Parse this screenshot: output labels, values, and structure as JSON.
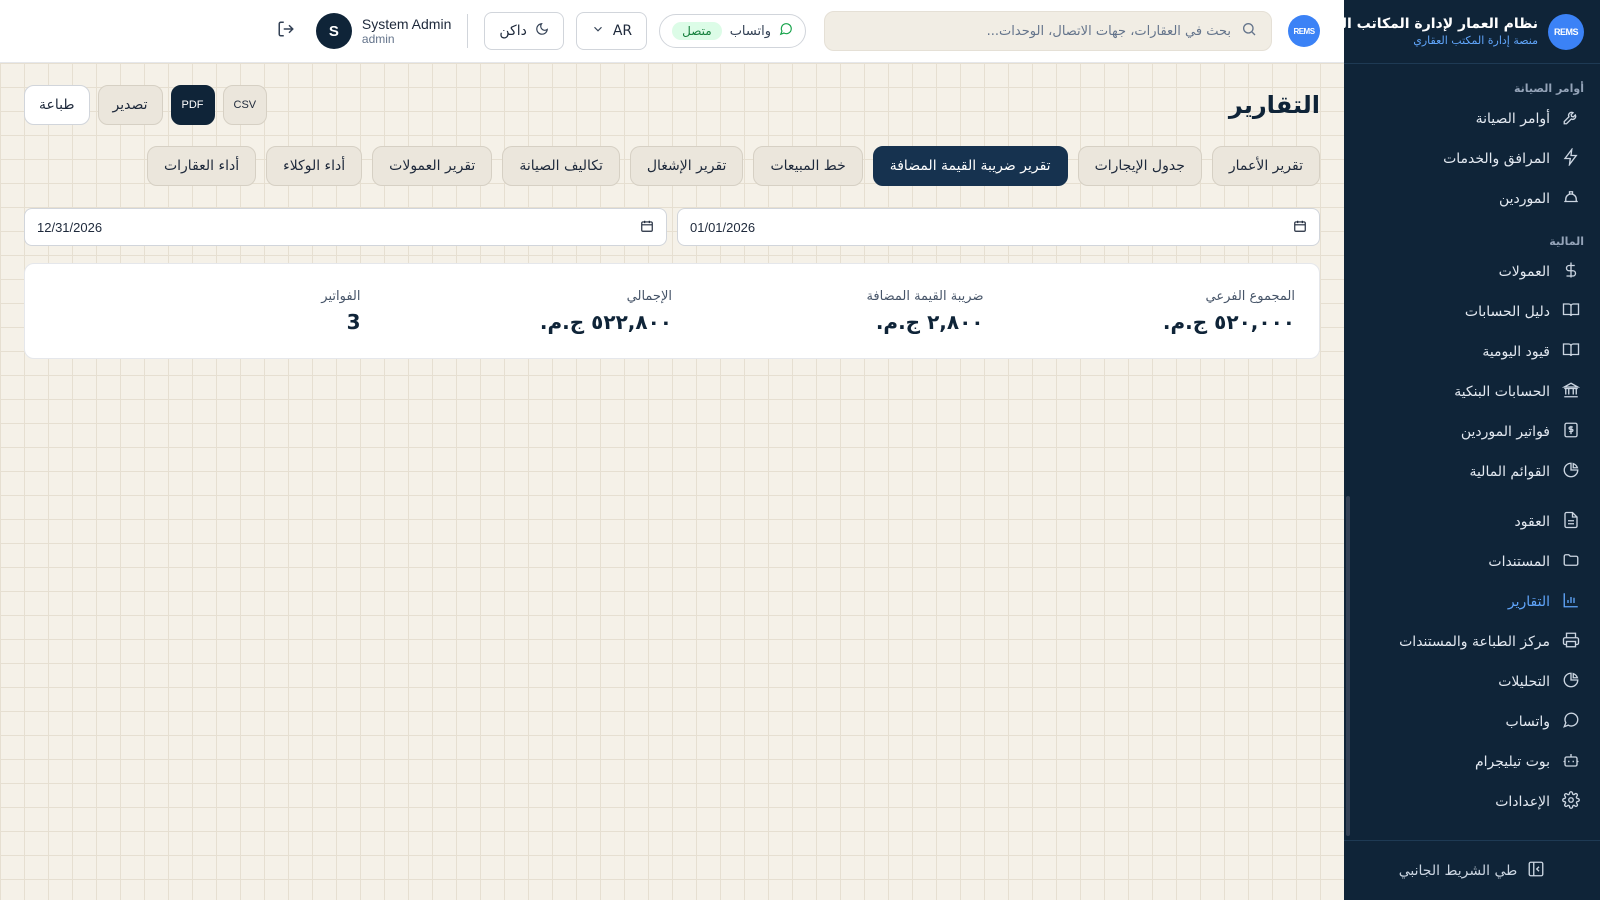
{
  "brand": {
    "logo_text": "REMS",
    "title": "نظام العمار لإدارة المكاتب العقارية",
    "subtitle": "منصة إدارة المكتب العقاري"
  },
  "sidebar": {
    "sections": [
      {
        "label": "أوامر الصيانة",
        "items": [
          {
            "label": "أوامر الصيانة",
            "icon": "wrench-icon"
          },
          {
            "label": "المرافق والخدمات",
            "icon": "bolt-icon"
          },
          {
            "label": "الموردين",
            "icon": "hard-hat-icon"
          }
        ]
      },
      {
        "label": "المالية",
        "items": [
          {
            "label": "العمولات",
            "icon": "dollar-icon"
          },
          {
            "label": "دليل الحسابات",
            "icon": "book-icon"
          },
          {
            "label": "قيود اليومية",
            "icon": "book-open-icon"
          },
          {
            "label": "الحسابات البنكية",
            "icon": "bank-icon"
          },
          {
            "label": "فواتير الموردين",
            "icon": "receipt-icon"
          },
          {
            "label": "القوائم المالية",
            "icon": "pie-chart-icon"
          }
        ]
      },
      {
        "label": "",
        "items": [
          {
            "label": "العقود",
            "icon": "file-text-icon"
          },
          {
            "label": "المستندات",
            "icon": "folder-icon"
          },
          {
            "label": "التقارير",
            "icon": "bar-chart-icon",
            "active": true
          },
          {
            "label": "مركز الطباعة والمستندات",
            "icon": "printer-icon"
          },
          {
            "label": "التحليلات",
            "icon": "pie-chart-icon"
          },
          {
            "label": "واتساب",
            "icon": "message-circle-icon"
          },
          {
            "label": "بوت تيليجرام",
            "icon": "bot-icon"
          },
          {
            "label": "الإعدادات",
            "icon": "gear-icon"
          }
        ]
      }
    ],
    "collapse_label": "طي الشريط الجانبي"
  },
  "header": {
    "search_placeholder": "بحث في العقارات، جهات الاتصال، الوحدات...",
    "whatsapp_label": "واتساب",
    "whatsapp_status": "متصل",
    "language": "AR",
    "theme_label": "داكن",
    "user_name": "System Admin",
    "user_role": "admin",
    "avatar_initial": "S"
  },
  "page": {
    "title": "التقارير",
    "actions": {
      "csv": "CSV",
      "pdf": "PDF",
      "export": "تصدير",
      "print": "طباعة"
    },
    "tabs": [
      {
        "label": "تقرير الأعمار"
      },
      {
        "label": "جدول الإيجارات"
      },
      {
        "label": "تقرير ضريبة القيمة المضافة",
        "active": true
      },
      {
        "label": "خط المبيعات"
      },
      {
        "label": "تقرير الإشغال"
      },
      {
        "label": "تكاليف الصيانة"
      },
      {
        "label": "تقرير العمولات"
      },
      {
        "label": "أداء الوكلاء"
      },
      {
        "label": "أداء العقارات"
      }
    ],
    "date_from": "01/01/2026",
    "date_to": "12/31/2026",
    "summary": [
      {
        "label": "المجموع الفرعي",
        "value": "٥٢٠,٠٠٠ ج.م."
      },
      {
        "label": "ضريبة القيمة المضافة",
        "value": "٢,٨٠٠ ج.م."
      },
      {
        "label": "الإجمالي",
        "value": "٥٢٢,٨٠٠ ج.م."
      },
      {
        "label": "الفواتير",
        "value": "3"
      }
    ]
  }
}
